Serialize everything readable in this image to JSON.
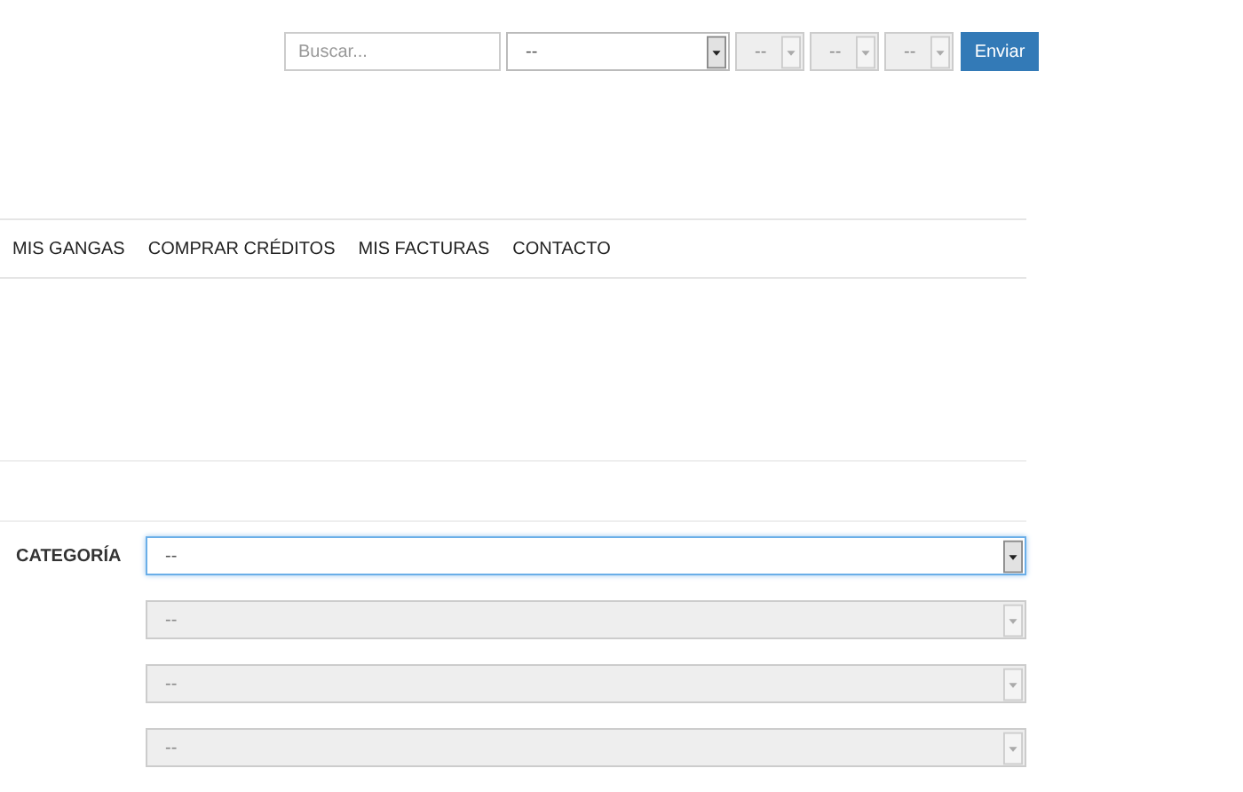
{
  "top_bar": {
    "search": {
      "placeholder": "Buscar..."
    },
    "selects": [
      {
        "value": "--",
        "disabled": false
      },
      {
        "value": "--",
        "disabled": true
      },
      {
        "value": "--",
        "disabled": true
      },
      {
        "value": "--",
        "disabled": true
      }
    ],
    "button": "Enviar"
  },
  "nav": [
    {
      "label": "MIS GANGAS"
    },
    {
      "label": "COMPRAR CRÉDITOS"
    },
    {
      "label": "MIS FACTURAS"
    },
    {
      "label": "CONTACTO"
    }
  ],
  "form": {
    "label": "CATEGORÍA",
    "selects": [
      {
        "value": "--",
        "disabled": false,
        "focused": true
      },
      {
        "value": "--",
        "disabled": true,
        "focused": false
      },
      {
        "value": "--",
        "disabled": true,
        "focused": false
      },
      {
        "value": "--",
        "disabled": true,
        "focused": false
      }
    ]
  }
}
